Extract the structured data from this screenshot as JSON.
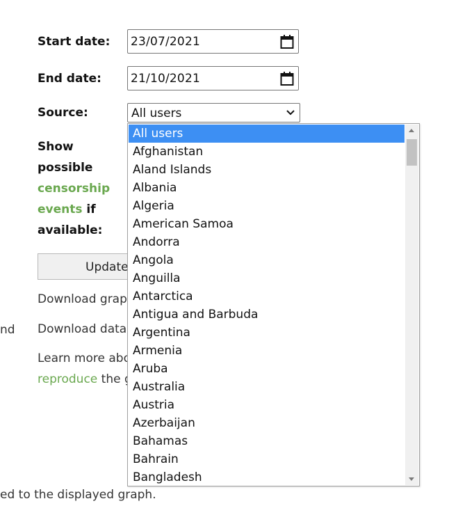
{
  "form": {
    "start_label": "Start date:",
    "start_value": "23/07/2021",
    "end_label": "End date:",
    "end_value": "21/10/2021",
    "source_label": "Source:",
    "source_value": "All users",
    "censorship_line1": "Show",
    "censorship_line2": "possible",
    "censorship_link_line1": "censorship",
    "censorship_link_line2": "events",
    "censorship_line4_suffix": " if",
    "censorship_line5": "available:",
    "update_button": "Update"
  },
  "links": {
    "download_graph": "Download graph",
    "download_data": "Download data",
    "learn_more": "Learn more about",
    "reproduce": "reproduce",
    "reproduce_suffix": " the g",
    "cut_left_text": "nd",
    "bottom_text": "ed to the displayed graph."
  },
  "dropdown": {
    "options": [
      "All users",
      "Afghanistan",
      "Aland Islands",
      "Albania",
      "Algeria",
      "American Samoa",
      "Andorra",
      "Angola",
      "Anguilla",
      "Antarctica",
      "Antigua and Barbuda",
      "Argentina",
      "Armenia",
      "Aruba",
      "Australia",
      "Austria",
      "Azerbaijan",
      "Bahamas",
      "Bahrain",
      "Bangladesh"
    ],
    "selected_index": 0,
    "highlight_color": "#3d8ff3"
  },
  "colors": {
    "link_green": "#6aa84f"
  }
}
